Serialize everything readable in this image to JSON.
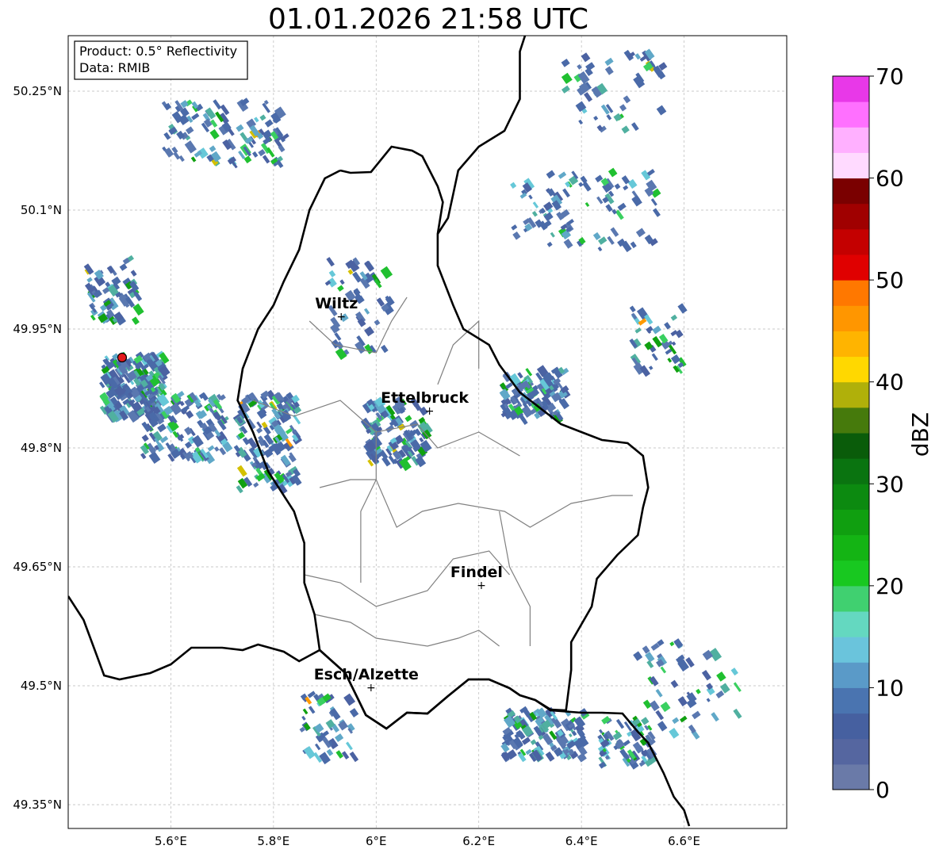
{
  "title": "01.01.2026 21:58 UTC",
  "info_box": {
    "product": "Product: 0.5° Reflectivity",
    "data": "Data: RMIB"
  },
  "map": {
    "lon_range": [
      5.4,
      6.8
    ],
    "lat_range": [
      49.32,
      50.32
    ],
    "grid": true,
    "lat_ticks": [
      {
        "value": 50.25,
        "label": "50.25°N"
      },
      {
        "value": 50.1,
        "label": "50.1°N"
      },
      {
        "value": 49.95,
        "label": "49.95°N"
      },
      {
        "value": 49.8,
        "label": "49.8°N"
      },
      {
        "value": 49.65,
        "label": "49.65°N"
      },
      {
        "value": 49.5,
        "label": "49.5°N"
      },
      {
        "value": 49.35,
        "label": "49.35°N"
      }
    ],
    "lon_ticks": [
      {
        "value": 5.6,
        "label": "5.6°E"
      },
      {
        "value": 5.8,
        "label": "5.8°E"
      },
      {
        "value": 6.0,
        "label": "6°E"
      },
      {
        "value": 6.2,
        "label": "6.2°E"
      },
      {
        "value": 6.4,
        "label": "6.4°E"
      },
      {
        "value": 6.6,
        "label": "6.6°E"
      }
    ],
    "radar_site": {
      "lon": 5.505,
      "lat": 49.914,
      "color": "#e31a1c"
    },
    "cities": [
      {
        "name": "Wiltz",
        "lon": 5.932,
        "lat": 49.966
      },
      {
        "name": "Ettelbruck",
        "lon": 6.104,
        "lat": 49.847
      },
      {
        "name": "Findel",
        "lon": 6.205,
        "lat": 49.627
      },
      {
        "name": "Esch/Alzette",
        "lon": 5.99,
        "lat": 49.498
      }
    ],
    "country_border": [
      [
        5.4,
        49.613
      ],
      [
        5.43,
        49.583
      ],
      [
        5.45,
        49.548
      ],
      [
        5.47,
        49.513
      ],
      [
        5.5,
        49.508
      ],
      [
        5.56,
        49.516
      ],
      [
        5.6,
        49.527
      ],
      [
        5.64,
        49.548
      ],
      [
        5.7,
        49.548
      ],
      [
        5.74,
        49.545
      ],
      [
        5.77,
        49.552
      ],
      [
        5.82,
        49.543
      ],
      [
        5.85,
        49.531
      ],
      [
        5.89,
        49.545
      ],
      [
        5.94,
        49.516
      ],
      [
        5.98,
        49.463
      ],
      [
        6.02,
        49.446
      ],
      [
        6.06,
        49.466
      ],
      [
        6.1,
        49.465
      ],
      [
        6.14,
        49.487
      ],
      [
        6.18,
        49.508
      ],
      [
        6.22,
        49.508
      ],
      [
        6.26,
        49.497
      ],
      [
        6.28,
        49.488
      ],
      [
        6.31,
        49.482
      ],
      [
        6.34,
        49.469
      ],
      [
        6.4,
        49.466
      ],
      [
        6.44,
        49.466
      ],
      [
        6.48,
        49.465
      ],
      [
        6.51,
        49.442
      ],
      [
        6.53,
        49.428
      ],
      [
        6.56,
        49.39
      ],
      [
        6.58,
        49.36
      ],
      [
        6.6,
        49.343
      ],
      [
        6.61,
        49.323
      ]
    ],
    "lux_border": [
      [
        5.93,
        50.15
      ],
      [
        5.95,
        50.147
      ],
      [
        5.99,
        50.148
      ],
      [
        6.03,
        50.18
      ],
      [
        6.07,
        50.175
      ],
      [
        6.09,
        50.168
      ],
      [
        6.12,
        50.13
      ],
      [
        6.13,
        50.11
      ],
      [
        6.12,
        50.07
      ],
      [
        6.12,
        50.03
      ],
      [
        6.15,
        49.98
      ],
      [
        6.17,
        49.95
      ],
      [
        6.22,
        49.93
      ],
      [
        6.24,
        49.905
      ],
      [
        6.28,
        49.87
      ],
      [
        6.32,
        49.85
      ],
      [
        6.34,
        49.84
      ],
      [
        6.36,
        49.83
      ],
      [
        6.4,
        49.82
      ],
      [
        6.44,
        49.81
      ],
      [
        6.49,
        49.806
      ],
      [
        6.52,
        49.79
      ],
      [
        6.53,
        49.75
      ],
      [
        6.52,
        49.725
      ],
      [
        6.51,
        49.69
      ],
      [
        6.47,
        49.665
      ],
      [
        6.43,
        49.635
      ],
      [
        6.42,
        49.6
      ],
      [
        6.38,
        49.555
      ],
      [
        6.38,
        49.52
      ],
      [
        6.37,
        49.469
      ],
      [
        6.34,
        49.47
      ],
      [
        6.31,
        49.482
      ],
      [
        6.28,
        49.488
      ],
      [
        6.26,
        49.497
      ],
      [
        6.22,
        49.508
      ],
      [
        6.18,
        49.508
      ],
      [
        6.14,
        49.487
      ],
      [
        6.1,
        49.465
      ],
      [
        6.06,
        49.466
      ],
      [
        6.02,
        49.446
      ],
      [
        5.98,
        49.463
      ],
      [
        5.94,
        49.516
      ],
      [
        5.89,
        49.545
      ],
      [
        5.88,
        49.59
      ],
      [
        5.86,
        49.63
      ],
      [
        5.86,
        49.68
      ],
      [
        5.84,
        49.72
      ],
      [
        5.79,
        49.77
      ],
      [
        5.76,
        49.82
      ],
      [
        5.73,
        49.86
      ],
      [
        5.74,
        49.9
      ],
      [
        5.77,
        49.95
      ],
      [
        5.8,
        49.98
      ],
      [
        5.82,
        50.01
      ],
      [
        5.85,
        50.05
      ],
      [
        5.87,
        50.1
      ],
      [
        5.9,
        50.14
      ],
      [
        5.93,
        50.15
      ]
    ],
    "germany_fr_border": [
      [
        6.12,
        50.07
      ],
      [
        6.14,
        50.09
      ],
      [
        6.15,
        50.12
      ],
      [
        6.16,
        50.15
      ],
      [
        6.2,
        50.18
      ],
      [
        6.25,
        50.2
      ],
      [
        6.28,
        50.24
      ],
      [
        6.28,
        50.3
      ],
      [
        6.29,
        50.32
      ]
    ],
    "canton_lines": [
      [
        [
          5.87,
          49.96
        ],
        [
          5.92,
          49.93
        ],
        [
          6.0,
          49.92
        ],
        [
          6.03,
          49.96
        ],
        [
          6.06,
          49.99
        ]
      ],
      [
        [
          5.76,
          49.86
        ],
        [
          5.84,
          49.84
        ],
        [
          5.93,
          49.86
        ],
        [
          6.0,
          49.82
        ],
        [
          6.08,
          49.83
        ],
        [
          6.12,
          49.8
        ],
        [
          6.2,
          49.82
        ],
        [
          6.28,
          49.79
        ]
      ],
      [
        [
          5.89,
          49.75
        ],
        [
          5.95,
          49.76
        ],
        [
          6.0,
          49.76
        ],
        [
          6.04,
          49.7
        ],
        [
          6.09,
          49.72
        ],
        [
          6.16,
          49.73
        ],
        [
          6.25,
          49.72
        ],
        [
          6.3,
          49.7
        ],
        [
          6.38,
          49.73
        ],
        [
          6.46,
          49.74
        ],
        [
          6.5,
          49.74
        ]
      ],
      [
        [
          5.86,
          49.64
        ],
        [
          5.93,
          49.63
        ],
        [
          6.0,
          49.6
        ],
        [
          6.1,
          49.62
        ],
        [
          6.15,
          49.66
        ],
        [
          6.22,
          49.67
        ],
        [
          6.26,
          49.64
        ]
      ],
      [
        [
          5.88,
          49.59
        ],
        [
          5.95,
          49.58
        ],
        [
          6.0,
          49.56
        ],
        [
          6.1,
          49.55
        ],
        [
          6.16,
          49.56
        ],
        [
          6.2,
          49.57
        ],
        [
          6.24,
          49.55
        ]
      ],
      [
        [
          6.0,
          49.82
        ],
        [
          6.0,
          49.76
        ],
        [
          5.97,
          49.72
        ],
        [
          5.97,
          49.63
        ]
      ],
      [
        [
          6.12,
          49.88
        ],
        [
          6.15,
          49.93
        ],
        [
          6.2,
          49.96
        ],
        [
          6.2,
          49.9
        ]
      ],
      [
        [
          6.24,
          49.72
        ],
        [
          6.26,
          49.65
        ],
        [
          6.3,
          49.6
        ],
        [
          6.3,
          49.55
        ]
      ]
    ]
  },
  "colorbar": {
    "label": "dBZ",
    "min": 0,
    "max": 70,
    "ticks": [
      0,
      10,
      20,
      30,
      40,
      50,
      60,
      70
    ],
    "colors": [
      "#6a7aa8",
      "#5566a0",
      "#4660a0",
      "#4a74b0",
      "#5a9ac8",
      "#6ac4dc",
      "#64d8c0",
      "#40d070",
      "#18c820",
      "#14b414",
      "#109f10",
      "#0c8a10",
      "#0a7410",
      "#0a5c0a",
      "#467a0c",
      "#b0b00a",
      "#ffd800",
      "#ffb400",
      "#ff9600",
      "#ff7800",
      "#e00000",
      "#c40000",
      "#a00000",
      "#7a0000",
      "#ffdaff",
      "#ffb0ff",
      "#ff70ff",
      "#e838e8"
    ]
  },
  "echo_palette": [
    "#4a6aa8",
    "#5a78b0",
    "#4b62a2",
    "#60a8c8",
    "#66c8d8",
    "#50b0a0",
    "#20c030",
    "#10a010",
    "#3ad060",
    "#d4c000",
    "#ff9a00"
  ]
}
